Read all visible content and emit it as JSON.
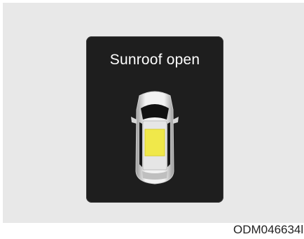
{
  "display": {
    "message": "Sunroof open"
  },
  "figure": {
    "code": "ODM046634l"
  },
  "colors": {
    "panel_bg": "#e8e8e8",
    "display_bg": "#1e1e1e",
    "sunroof_highlight": "#f0e84a"
  },
  "icons": {
    "car": "car-top-view-icon",
    "sunroof": "sunroof-open-indicator"
  }
}
